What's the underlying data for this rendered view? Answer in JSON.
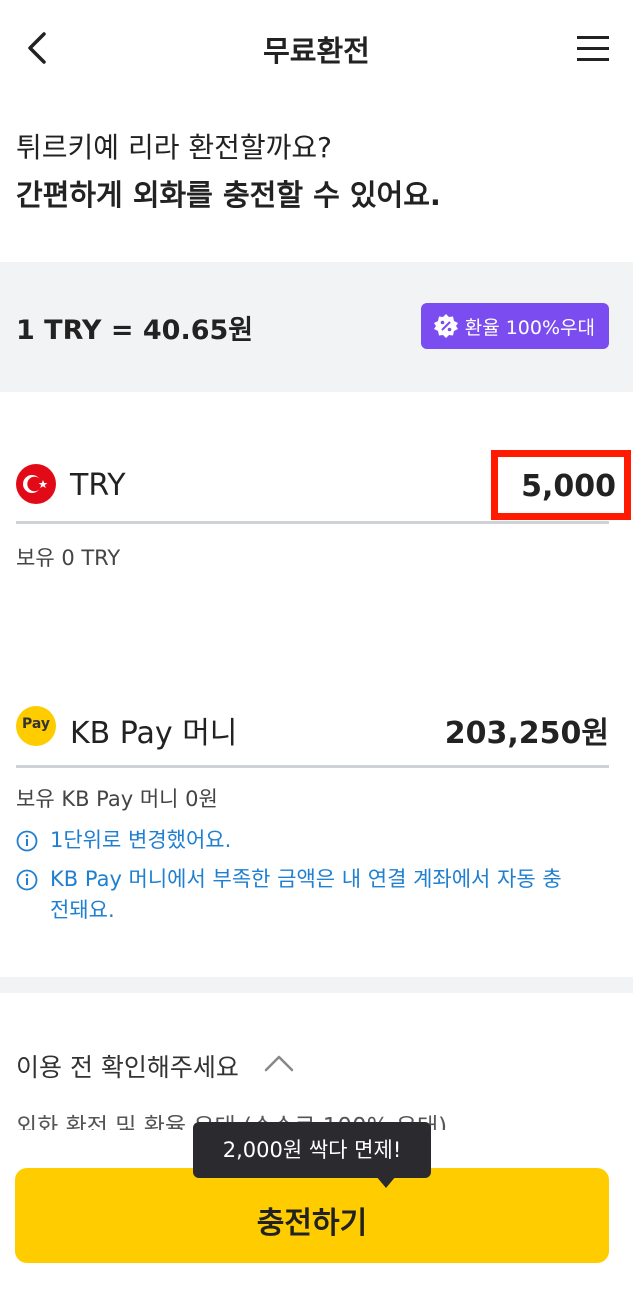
{
  "header": {
    "title": "무료환전",
    "back_icon": "chevron-left-icon",
    "menu_icon": "hamburger-menu-icon"
  },
  "intro": {
    "question": "튀르키예 리라 환전할까요?",
    "subtitle": "간편하게 외화를 충전할 수 있어요."
  },
  "rate": {
    "text": "1 TRY = 40.65원",
    "badge_label": "환율 100%우대",
    "badge_color": "#7b4cf0"
  },
  "foreign": {
    "currency": "TRY",
    "amount": "5,000",
    "holding": "보유 0 TRY",
    "flag_icon": "turkey-flag-icon"
  },
  "kbpay": {
    "label": "KB Pay 머니",
    "amount": "203,250원",
    "holding": "보유 KB Pay 머니 0원",
    "icon_text": "Pay"
  },
  "notices": [
    "1단위로 변경했어요.",
    "KB Pay 머니에서 부족한 금액은 내 연결 계좌에서 자동 충전돼요."
  ],
  "confirm": {
    "title": "이용 전 확인해주세요",
    "partial_line": "외화 환전 및 환율 우대 (수수료 100% 우대)"
  },
  "tooltip": {
    "text": "2,000원 싹다 면제!"
  },
  "cta": {
    "label": "충전하기",
    "color": "#ffcc00"
  },
  "colors": {
    "accent_purple": "#7b4cf0",
    "info_blue": "#1f7fd0",
    "highlight_red": "#ff1a00",
    "cta_yellow": "#ffcc00"
  }
}
